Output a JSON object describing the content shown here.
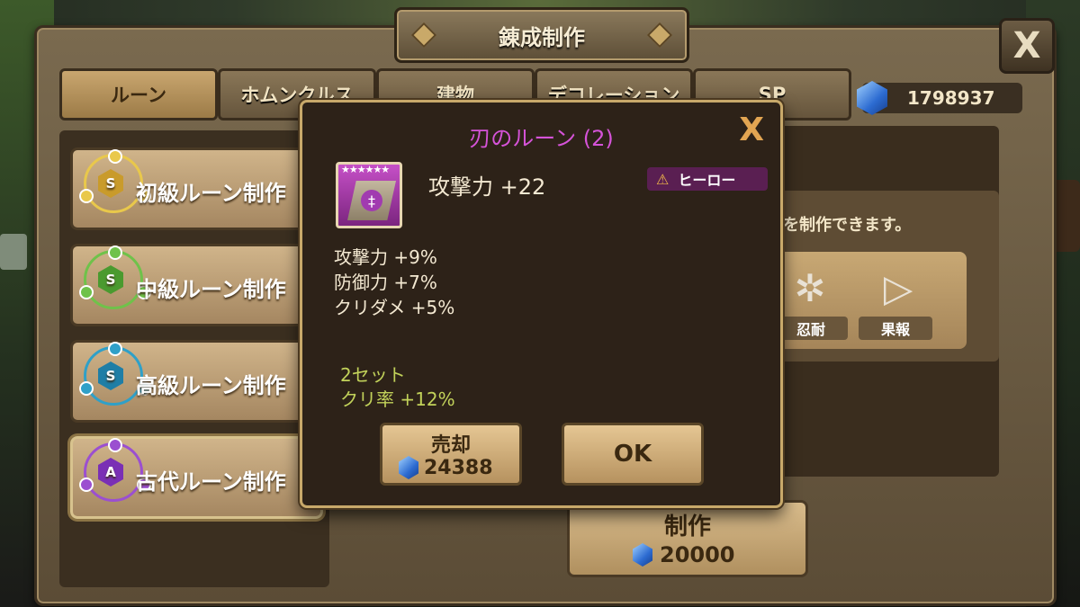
{
  "window": {
    "title": "錬成制作",
    "close_label": "X"
  },
  "tabs": [
    {
      "label": "ルーン",
      "active": true
    },
    {
      "label": "ホムンクルス"
    },
    {
      "label": "建物"
    },
    {
      "label": "デコレーション"
    },
    {
      "label": "SP"
    }
  ],
  "currency": {
    "icon": "crystal-gem-icon",
    "value": "1798937"
  },
  "rune_menu": [
    {
      "label": "初級ルーン制作",
      "icon": "beginner-rune-circle-icon",
      "color": "#e9c84b"
    },
    {
      "label": "中級ルーン制作",
      "icon": "intermediate-rune-circle-icon",
      "color": "#6fc24a"
    },
    {
      "label": "高級ルーン制作",
      "icon": "advanced-rune-circle-icon",
      "color": "#2fa0c8"
    },
    {
      "label": "古代ルーン制作",
      "icon": "ancient-rune-circle-icon",
      "color": "#9b4fd0",
      "active": true
    }
  ],
  "crafting": {
    "hint": "ンを制作できます。",
    "sets": [
      {
        "label": "忍耐",
        "icon": "endure-rune-icon"
      },
      {
        "label": "果報",
        "icon": "reward-rune-icon"
      }
    ],
    "make_button": {
      "label": "制作",
      "cost": "20000"
    }
  },
  "rune_popup": {
    "title": "刃のルーン (2)",
    "close_label": "X",
    "stars": "★★★★★★",
    "grade": "ヒーロー",
    "main_stat": "攻撃力 +22",
    "sub_stats": [
      "攻撃力 +9%",
      "防御力 +7%",
      "クリダメ +5%"
    ],
    "set_bonus": [
      "2セット",
      "クリ率 +12%"
    ],
    "sell_button": {
      "label": "売却",
      "price": "24388"
    },
    "ok_button": {
      "label": "OK"
    }
  },
  "colors": {
    "title_purple": "#d553d8",
    "close_orange": "#e2a552",
    "set_bonus_green": "#c2d25a",
    "grade_bg": "#5a1f52"
  }
}
